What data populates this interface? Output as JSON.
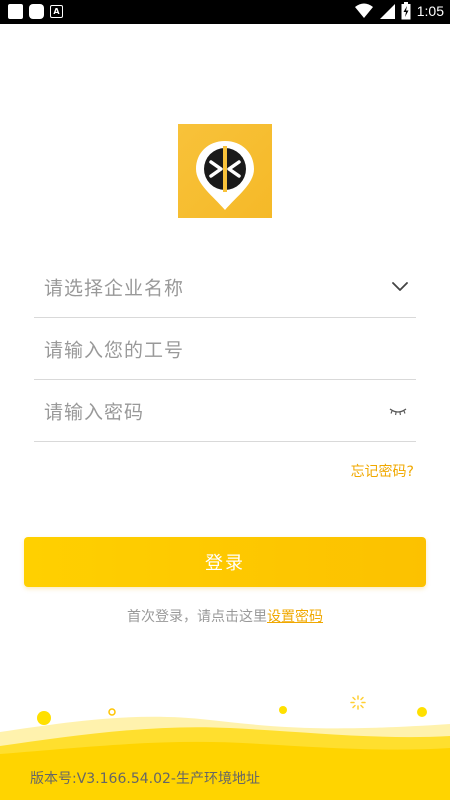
{
  "status_bar": {
    "time": "1:05",
    "icons": [
      "square-notification-icon",
      "rounded-notification-icon",
      "a-icon",
      "wifi-icon",
      "signal-icon",
      "battery-charging-icon"
    ],
    "a_icon_glyph": "A"
  },
  "logo": {
    "icon": "location-pin-logo-icon",
    "color": "#f8c23a"
  },
  "form": {
    "company": {
      "placeholder": "请选择企业名称",
      "icon": "chevron-down-icon"
    },
    "employee_id": {
      "placeholder": "请输入您的工号"
    },
    "password": {
      "placeholder": "请输入密码",
      "icon": "eye-closed-icon"
    },
    "forgot_label": "忘记密码?",
    "login_label": "登录"
  },
  "hint": {
    "text": "首次登录，请点击这里",
    "link_label": "设置密码"
  },
  "footer": {
    "version": "版本号:V3.166.54.02-生产环境地址"
  },
  "colors": {
    "accent": "#fcc100",
    "link": "#f0a800",
    "placeholder": "#999999"
  }
}
